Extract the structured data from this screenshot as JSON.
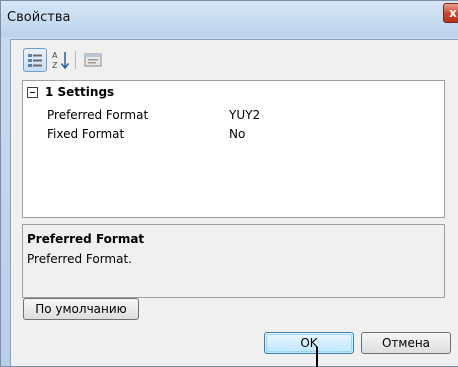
{
  "window": {
    "title": "Свойства",
    "close_glyph": "x"
  },
  "toolbar": {
    "buttons": [
      {
        "icon": "categorized-icon",
        "active": true
      },
      {
        "icon": "alphabetical-sort-icon",
        "active": false
      },
      {
        "icon": "property-pages-icon",
        "active": false
      }
    ]
  },
  "grid": {
    "category": {
      "label": "1 Settings",
      "expanded": true
    },
    "properties": [
      {
        "name": "Preferred Format",
        "value": "YUY2"
      },
      {
        "name": "Fixed Format",
        "value": "No"
      }
    ]
  },
  "help": {
    "title": "Preferred Format",
    "description": "Preferred Format."
  },
  "buttons": {
    "default_label": "По умолчанию",
    "ok_label": "OK",
    "cancel_label": "Отмена"
  },
  "colors": {
    "titlebar": "#c9dcf0",
    "close_button": "#c9442c",
    "ok_button_border": "#3c7fb1"
  }
}
